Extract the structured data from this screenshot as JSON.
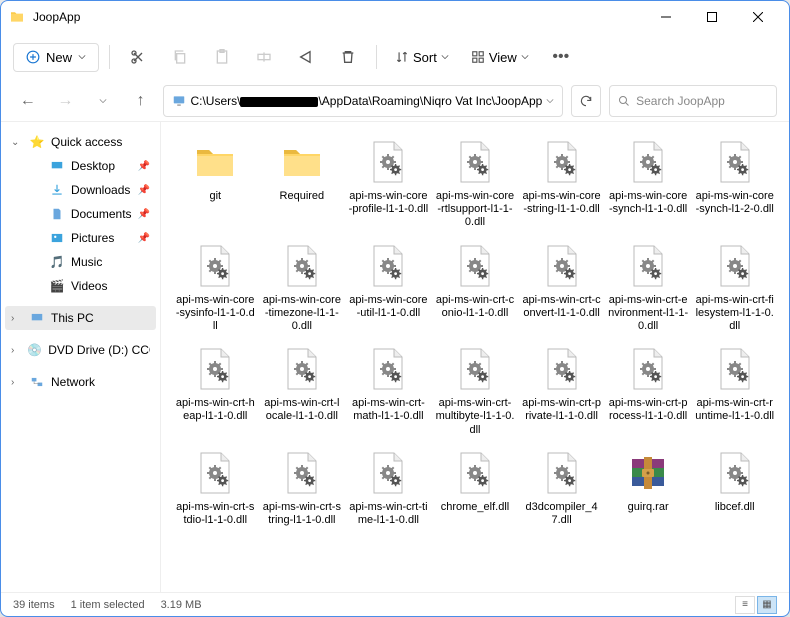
{
  "window": {
    "title": "JoopApp"
  },
  "toolbar": {
    "new": "New",
    "sort": "Sort",
    "view": "View"
  },
  "address": {
    "path_prefix": "C:\\Users\\",
    "path_suffix": "\\AppData\\Roaming\\Niqro Vat Inc\\JoopApp"
  },
  "search": {
    "placeholder": "Search JoopApp"
  },
  "sidebar": {
    "quick": "Quick access",
    "desktop": "Desktop",
    "downloads": "Downloads",
    "documents": "Documents",
    "pictures": "Pictures",
    "music": "Music",
    "videos": "Videos",
    "thispc": "This PC",
    "dvd": "DVD Drive (D:) CCCO",
    "network": "Network"
  },
  "items": [
    {
      "name": "git",
      "type": "folder"
    },
    {
      "name": "Required",
      "type": "folder"
    },
    {
      "name": "api-ms-win-core-profile-l1-1-0.dll",
      "type": "dll"
    },
    {
      "name": "api-ms-win-core-rtlsupport-l1-1-0.dll",
      "type": "dll"
    },
    {
      "name": "api-ms-win-core-string-l1-1-0.dll",
      "type": "dll"
    },
    {
      "name": "api-ms-win-core-synch-l1-1-0.dll",
      "type": "dll"
    },
    {
      "name": "api-ms-win-core-synch-l1-2-0.dll",
      "type": "dll"
    },
    {
      "name": "api-ms-win-core-sysinfo-l1-1-0.dll",
      "type": "dll"
    },
    {
      "name": "api-ms-win-core-timezone-l1-1-0.dll",
      "type": "dll"
    },
    {
      "name": "api-ms-win-core-util-l1-1-0.dll",
      "type": "dll"
    },
    {
      "name": "api-ms-win-crt-conio-l1-1-0.dll",
      "type": "dll"
    },
    {
      "name": "api-ms-win-crt-convert-l1-1-0.dll",
      "type": "dll"
    },
    {
      "name": "api-ms-win-crt-environment-l1-1-0.dll",
      "type": "dll"
    },
    {
      "name": "api-ms-win-crt-filesystem-l1-1-0.dll",
      "type": "dll"
    },
    {
      "name": "api-ms-win-crt-heap-l1-1-0.dll",
      "type": "dll"
    },
    {
      "name": "api-ms-win-crt-locale-l1-1-0.dll",
      "type": "dll"
    },
    {
      "name": "api-ms-win-crt-math-l1-1-0.dll",
      "type": "dll"
    },
    {
      "name": "api-ms-win-crt-multibyte-l1-1-0.dll",
      "type": "dll"
    },
    {
      "name": "api-ms-win-crt-private-l1-1-0.dll",
      "type": "dll"
    },
    {
      "name": "api-ms-win-crt-process-l1-1-0.dll",
      "type": "dll"
    },
    {
      "name": "api-ms-win-crt-runtime-l1-1-0.dll",
      "type": "dll"
    },
    {
      "name": "api-ms-win-crt-stdio-l1-1-0.dll",
      "type": "dll"
    },
    {
      "name": "api-ms-win-crt-string-l1-1-0.dll",
      "type": "dll"
    },
    {
      "name": "api-ms-win-crt-time-l1-1-0.dll",
      "type": "dll"
    },
    {
      "name": "chrome_elf.dll",
      "type": "dll"
    },
    {
      "name": "d3dcompiler_47.dll",
      "type": "dll"
    },
    {
      "name": "guirq.rar",
      "type": "rar"
    },
    {
      "name": "libcef.dll",
      "type": "dll"
    }
  ],
  "status": {
    "count": "39 items",
    "selected": "1 item selected",
    "size": "3.19 MB"
  }
}
